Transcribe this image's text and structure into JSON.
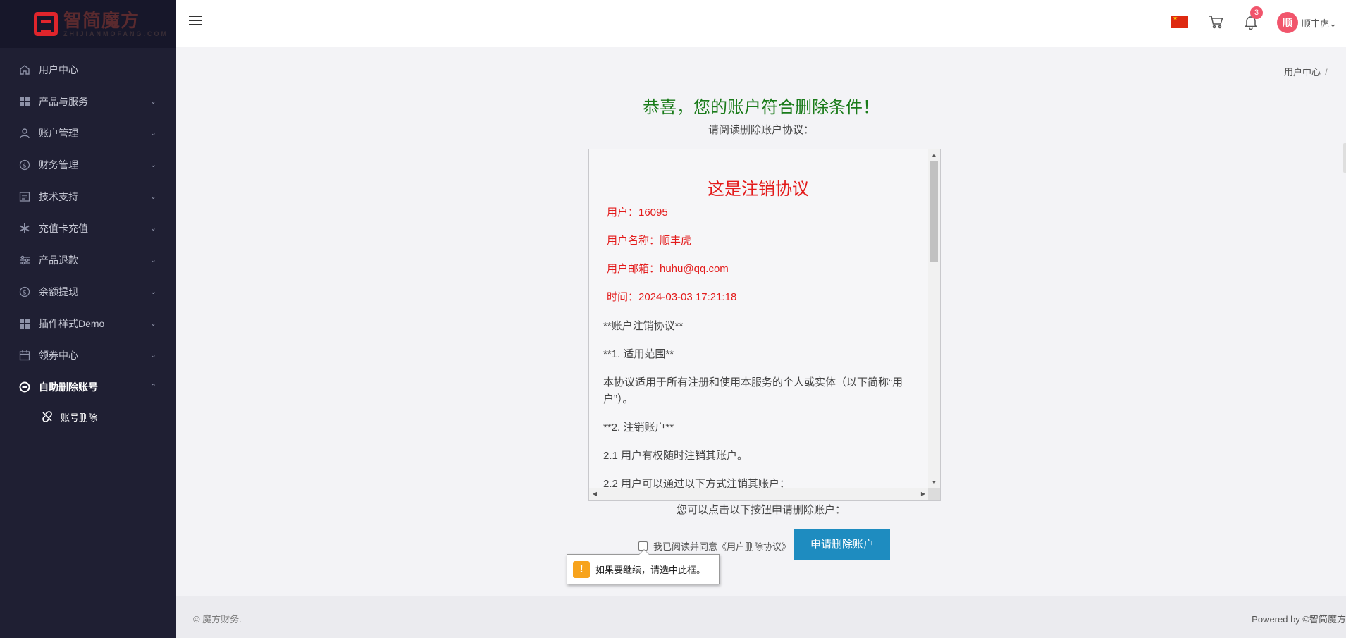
{
  "logo": {
    "name": "智简魔方",
    "sub": "ZHIJIANMOFANG.COM"
  },
  "sidebar": {
    "items": [
      {
        "label": "用户中心",
        "icon": "home-icon",
        "chevron": ""
      },
      {
        "label": "产品与服务",
        "icon": "grid-icon",
        "chevron": "⌄"
      },
      {
        "label": "账户管理",
        "icon": "user-icon",
        "chevron": "⌄"
      },
      {
        "label": "财务管理",
        "icon": "dollar-icon",
        "chevron": "⌄"
      },
      {
        "label": "技术支持",
        "icon": "ticket-icon",
        "chevron": "⌄"
      },
      {
        "label": "充值卡充值",
        "icon": "asterisk-icon",
        "chevron": "⌄"
      },
      {
        "label": "产品退款",
        "icon": "sliders-icon",
        "chevron": "⌄"
      },
      {
        "label": "余额提现",
        "icon": "dollar-icon",
        "chevron": "⌄"
      },
      {
        "label": "插件样式Demo",
        "icon": "grid-icon",
        "chevron": "⌄"
      },
      {
        "label": "领券中心",
        "icon": "calendar-icon",
        "chevron": "⌄"
      },
      {
        "label": "自助删除账号",
        "icon": "minus-circle-icon",
        "chevron": "⌃"
      }
    ],
    "sub_items": [
      {
        "label": "账号删除",
        "icon": "unlink-icon"
      }
    ]
  },
  "topbar": {
    "notification_count": "3",
    "avatar_initial": "顺",
    "username": "顺丰虎",
    "username_chevron": "⌄"
  },
  "breadcrumb": {
    "current": "用户中心",
    "separator": "/"
  },
  "main": {
    "heading": "恭喜，您的账户符合删除条件！",
    "subheading": "请阅读删除账户协议：",
    "agreement": {
      "title": "这是注销协议",
      "user_line": "用户：16095",
      "username_line": "用户名称：顺丰虎",
      "email_line": "用户邮箱：huhu@qq.com",
      "time_line": "时间：2024-03-03 17:21:18",
      "paragraphs": [
        "**账户注销协议**",
        "**1. 适用范围**",
        "本协议适用于所有注册和使用本服务的个人或实体（以下简称“用户”）。",
        "**2. 注销账户**",
        "2.1 用户有权随时注销其账户。",
        "2.2 用户可以通过以下方式注销其账户："
      ]
    },
    "hint": "您可以点击以下按钮申请删除账户：",
    "agree_label": "我已阅读并同意《用户删除协议》",
    "apply_button": "申请删除账户",
    "tooltip": "如果要继续，请选中此框。"
  },
  "footer": {
    "left": "© 魔方财务.",
    "right": "Powered by ©智简魔方"
  },
  "colors": {
    "sidebar_bg": "#1f1f33",
    "heading_green": "#1a7b1a",
    "agreement_red": "#e31b1b",
    "button_blue": "#1e8cc0",
    "badge_red": "#f1556c",
    "warning_orange": "#f7a31c"
  }
}
